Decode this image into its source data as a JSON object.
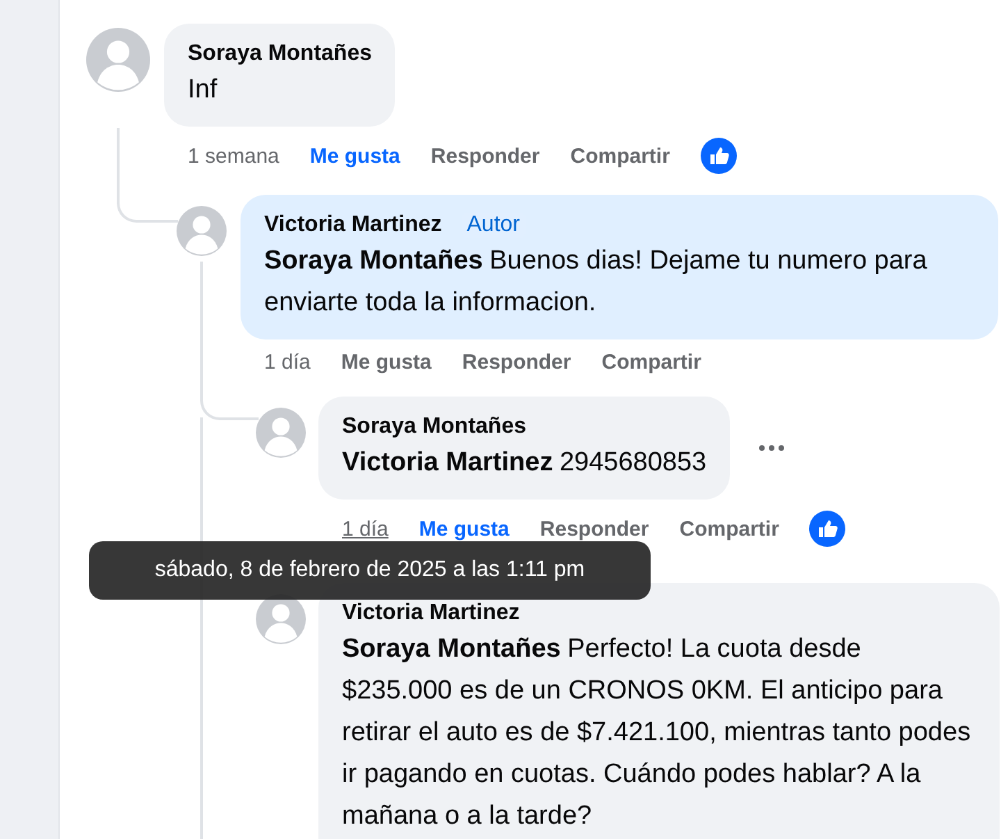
{
  "comments": [
    {
      "author": "Soraya Montañes",
      "text": "Inf",
      "time": "1 semana",
      "time_hovered": false,
      "liked": true,
      "reacted": true,
      "actions": [
        "Me gusta",
        "Responder",
        "Compartir"
      ],
      "children": [
        {
          "author": "Victoria Martinez",
          "badge": "Autor",
          "highlight": true,
          "mention": "Soraya Montañes",
          "text": "Buenos dias! Dejame tu numero para enviarte toda la informacion.",
          "time": "1 día",
          "time_hovered": false,
          "liked": false,
          "actions": [
            "Me gusta",
            "Responder",
            "Compartir"
          ],
          "children": [
            {
              "author": "Soraya Montañes",
              "highlight": false,
              "mention": "Victoria Martinez",
              "text": "2945680853",
              "time": "1 día",
              "time_hovered": true,
              "liked": true,
              "reacted": true,
              "more": true,
              "actions": [
                "Me gusta",
                "Responder",
                "Compartir"
              ]
            },
            {
              "author": "Victoria Martinez",
              "highlight": false,
              "mention": "Soraya Montañes",
              "text": "Perfecto! La cuota desde $235.000 es de un CRONOS 0KM. El anticipo para retirar el auto es de $7.421.100, mientras tanto podes ir pagando en cuotas. Cuándo podes hablar? A la mañana o a la tarde?"
            }
          ]
        }
      ]
    }
  ],
  "tooltip": {
    "text": "sábado, 8 de febrero de 2025 a las 1:11 pm"
  }
}
